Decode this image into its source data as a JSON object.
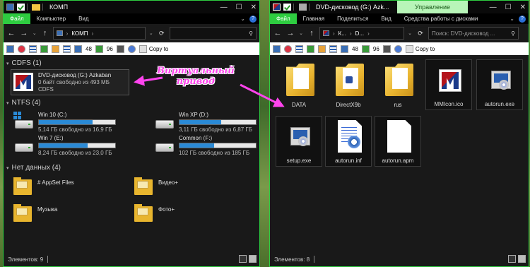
{
  "windows": [
    {
      "title": "КОМП",
      "ribbon_tabs": [
        "Файл",
        "Компьютер",
        "Вид"
      ],
      "address": [
        "КОМП"
      ],
      "search_placeholder": "",
      "toolbar": {
        "num1": "48",
        "num2": "96",
        "copy_label": "Copy to"
      },
      "groups": {
        "cdfs": "CDFS (1)",
        "ntfs": "NTFS (4)",
        "nodata": "Нет данных (4)"
      },
      "dvd": {
        "name": "DVD-дисковод (G:) Azkaban",
        "free": "0 байт свободно из 493 МБ",
        "fs": "CDFS"
      },
      "drives": [
        {
          "name": "Win 10 (C:)",
          "free": "5,14 ГБ свободно из 16,9 ГБ",
          "used_fraction": 0.7,
          "os_icon": true
        },
        {
          "name": "Win XP (D:)",
          "free": "3,11 ГБ свободно из 6,87 ГБ",
          "used_fraction": 0.55,
          "os_icon": false
        },
        {
          "name": "Win 7 (E:)",
          "free": "8,24 ГБ свободно из 23,0 ГБ",
          "used_fraction": 0.64,
          "os_icon": false
        },
        {
          "name": "Common (F:)",
          "free": "102 ГБ свободно из 185 ГБ",
          "used_fraction": 0.45,
          "os_icon": false
        }
      ],
      "folders": [
        {
          "name": "# AppSet Files"
        },
        {
          "name": "Видео+"
        },
        {
          "name": "Музыка"
        },
        {
          "name": "Фото+"
        }
      ],
      "status": "Элементов: 9"
    },
    {
      "title": "DVD-дисковод (G:) Azk...",
      "contextual_tab": "Управление",
      "ribbon_tabs": [
        "Файл",
        "Главная",
        "Поделиться",
        "Вид",
        "Средства работы с дисками"
      ],
      "address": [
        "К...",
        "D..."
      ],
      "search_placeholder": "Поиск: DVD-дисковод ...",
      "toolbar": {
        "num1": "48",
        "num2": "96",
        "copy_label": "Copy to"
      },
      "files": [
        {
          "name": "DATA",
          "kind": "folder"
        },
        {
          "name": "DirectX9b",
          "kind": "folder-dx"
        },
        {
          "name": "rus",
          "kind": "folder"
        },
        {
          "name": "MMIcon.ico",
          "kind": "ico"
        },
        {
          "name": "autorun.exe",
          "kind": "exe"
        },
        {
          "name": "setup.exe",
          "kind": "exe"
        },
        {
          "name": "autorun.inf",
          "kind": "inf"
        },
        {
          "name": "autorun.apm",
          "kind": "blank"
        }
      ],
      "status": "Элементов: 8"
    }
  ],
  "annotation": {
    "line1": "Виртуальный",
    "line2": "привод",
    "color": "#ff44ee"
  },
  "icons": {
    "help": "?",
    "minimize": "—",
    "maximize": "☐",
    "close": "✕",
    "back": "←",
    "forward": "→",
    "up": "↑",
    "search": "⚲",
    "collapse": "▾",
    "expand_ribbon": "⌄",
    "refresh": "⟳",
    "dropdown": "⌄"
  }
}
